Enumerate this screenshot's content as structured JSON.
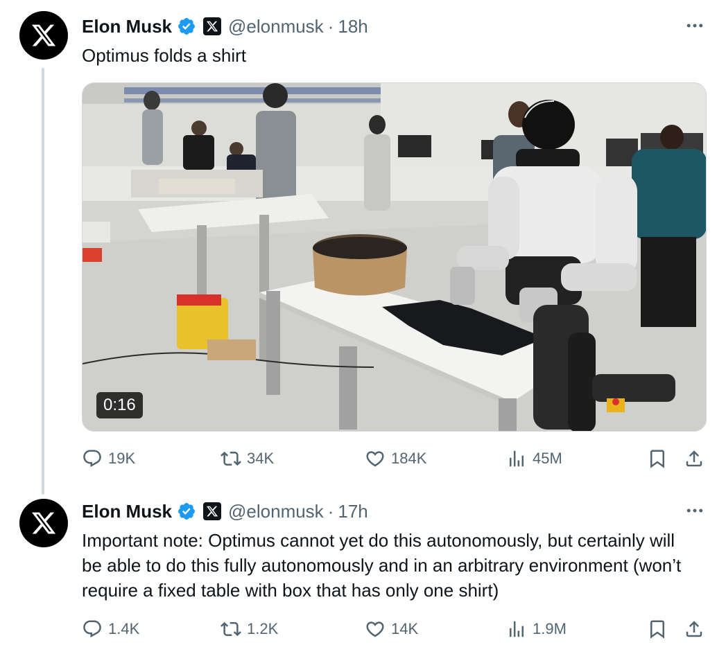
{
  "tweets": [
    {
      "author_name": "Elon Musk",
      "handle": "@elonmusk",
      "separator": "·",
      "time": "18h",
      "text": "Optimus folds a shirt",
      "media": {
        "type": "video",
        "duration": "0:16",
        "description_icons": [
          "robot",
          "table",
          "shirt",
          "basket"
        ]
      },
      "stats": {
        "replies": "19K",
        "reposts": "34K",
        "likes": "184K",
        "views": "45M"
      }
    },
    {
      "author_name": "Elon Musk",
      "handle": "@elonmusk",
      "separator": "·",
      "time": "17h",
      "text": "Important note: Optimus cannot yet do this autonomously, but certainly will be able to do this fully autonomously and in an arbitrary environment (won’t require a fixed table with box that has only one shirt)",
      "stats": {
        "replies": "1.4K",
        "reposts": "1.2K",
        "likes": "14K",
        "views": "1.9M"
      }
    }
  ],
  "colors": {
    "text_primary": "#0f1419",
    "text_secondary": "#536471",
    "verified_blue": "#1d9bf0",
    "thread_line": "#cfd9de"
  }
}
